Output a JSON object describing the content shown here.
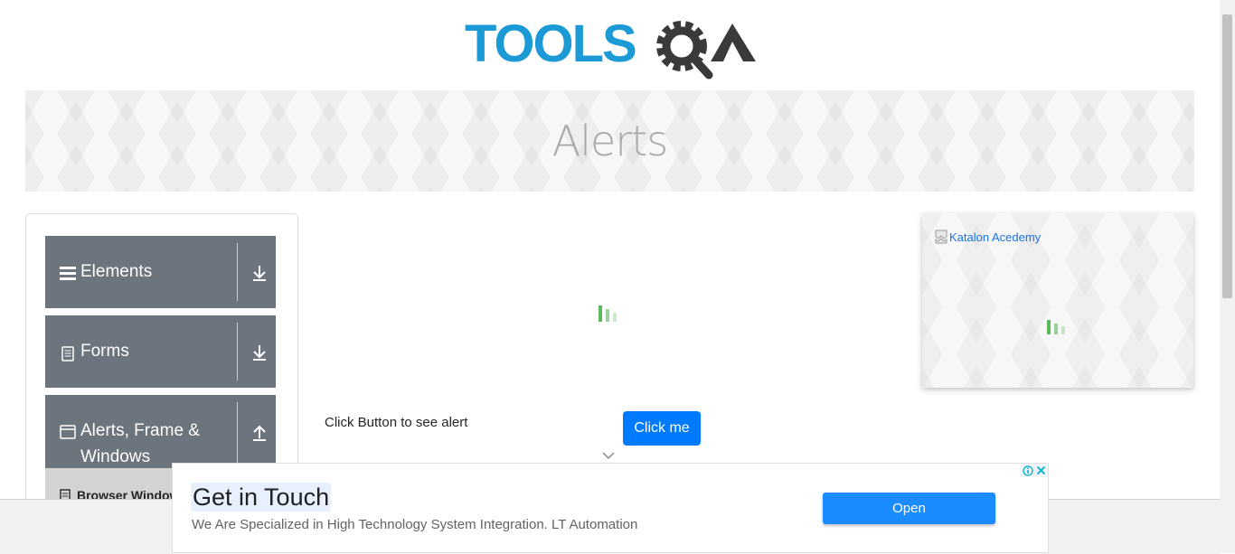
{
  "header": {
    "logo_text": "TOOLSQA",
    "banner_title": "Alerts"
  },
  "sidebar": {
    "groups": [
      {
        "label": "Elements",
        "icon": "hamburger-icon",
        "arrow": "download-arrow-icon"
      },
      {
        "label": "Forms",
        "icon": "document-icon",
        "arrow": "download-arrow-icon"
      },
      {
        "label_line1": "Alerts, Frame &",
        "label_line2": "Windows",
        "icon": "window-icon",
        "arrow": "upload-arrow-icon"
      }
    ],
    "sub_items": [
      {
        "label": "Browser Windows"
      }
    ]
  },
  "main": {
    "alert_label": "Click Button to see alert",
    "button_label": "Click me"
  },
  "side_ad": {
    "alt_text": "Katalon Acedemy"
  },
  "bottom_ad": {
    "headline": "Get in Touch",
    "description": "We Are Specialized in High Technology System Integration. LT Automation",
    "button_label": "Open"
  },
  "colors": {
    "sidebar_bg": "#6c757d",
    "primary_button": "#007bff",
    "ad_button": "#1a8cff",
    "loader_green": "#5cb85c",
    "banner_title": "#a9a9a9"
  }
}
